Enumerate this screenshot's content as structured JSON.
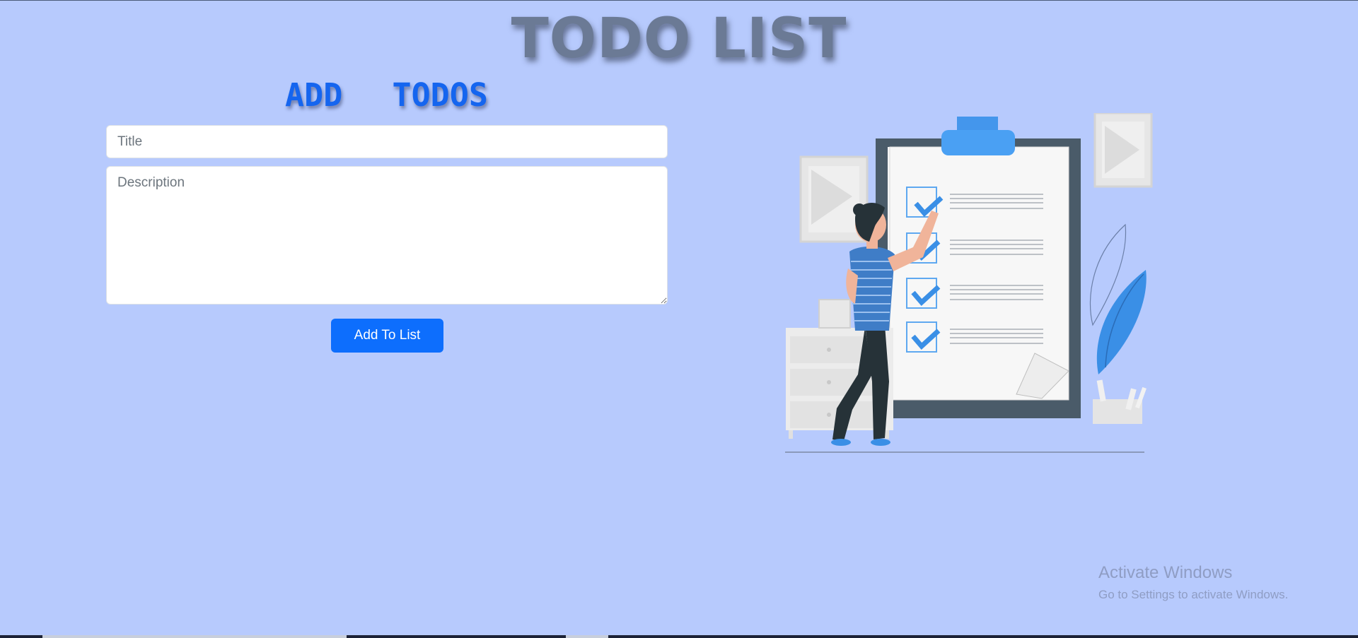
{
  "page": {
    "title": "TODO LIST",
    "background": "#b7cafd"
  },
  "form": {
    "heading": "ADD  TODOS",
    "title_placeholder": "Title",
    "title_value": "",
    "description_placeholder": "Description",
    "description_value": "",
    "submit_label": "Add To List",
    "accent": "#0d6efd"
  },
  "illustration": {
    "icon": "checklist-illustration",
    "checked_items": 4
  },
  "watermark": {
    "title": "Activate Windows",
    "subtitle": "Go to Settings to activate Windows."
  }
}
